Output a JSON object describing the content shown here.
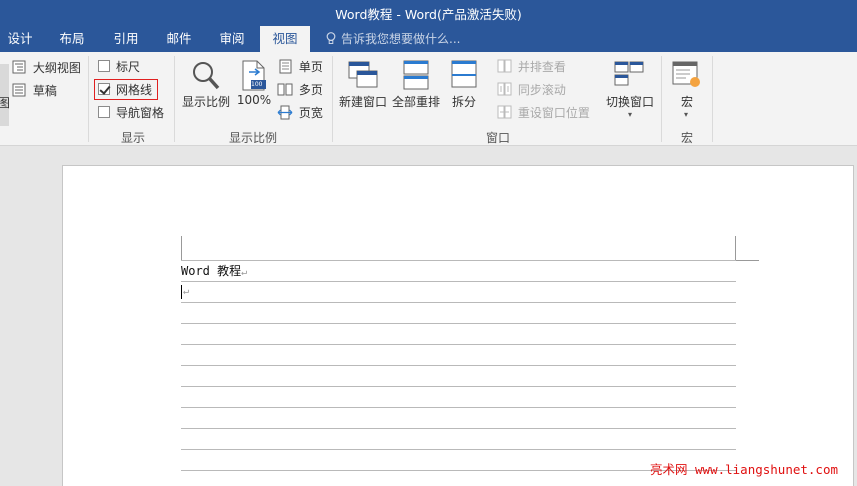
{
  "window": {
    "title": "Word教程 - Word(产品激活失败)"
  },
  "tabs": [
    {
      "label": "设计"
    },
    {
      "label": "布局"
    },
    {
      "label": "引用"
    },
    {
      "label": "邮件"
    },
    {
      "label": "审阅"
    },
    {
      "label": "视图"
    }
  ],
  "tell_me": {
    "placeholder": "告诉我您想要做什么..."
  },
  "ribbon": {
    "views": {
      "outline": "大纲视图",
      "draft": "草稿",
      "partial": "图"
    },
    "show": {
      "ruler": "标尺",
      "gridlines": "网格线",
      "nav_pane": "导航窗格",
      "label": "显示",
      "ruler_checked": false,
      "gridlines_checked": true,
      "nav_pane_checked": false
    },
    "zoom": {
      "zoom_btn": "显示比例",
      "zoom100": "100%",
      "zoom100_badge": "100",
      "one_page": "单页",
      "multi_page": "多页",
      "page_width": "页宽",
      "label": "显示比例"
    },
    "window": {
      "new_window": "新建窗口",
      "arrange_all": "全部重排",
      "split": "拆分",
      "side_by_side": "并排查看",
      "sync_scroll": "同步滚动",
      "reset_pos": "重设窗口位置",
      "switch_windows": "切换窗口",
      "label": "窗口"
    },
    "macros": {
      "macros_btn": "宏",
      "label": "宏"
    }
  },
  "document": {
    "line1": "Word 教程",
    "para_mark": "↵"
  },
  "watermark": "亮术网 www.liangshunet.com",
  "colors": {
    "accent": "#2b579a",
    "highlight_box": "#e02020",
    "watermark": "#e01010"
  }
}
